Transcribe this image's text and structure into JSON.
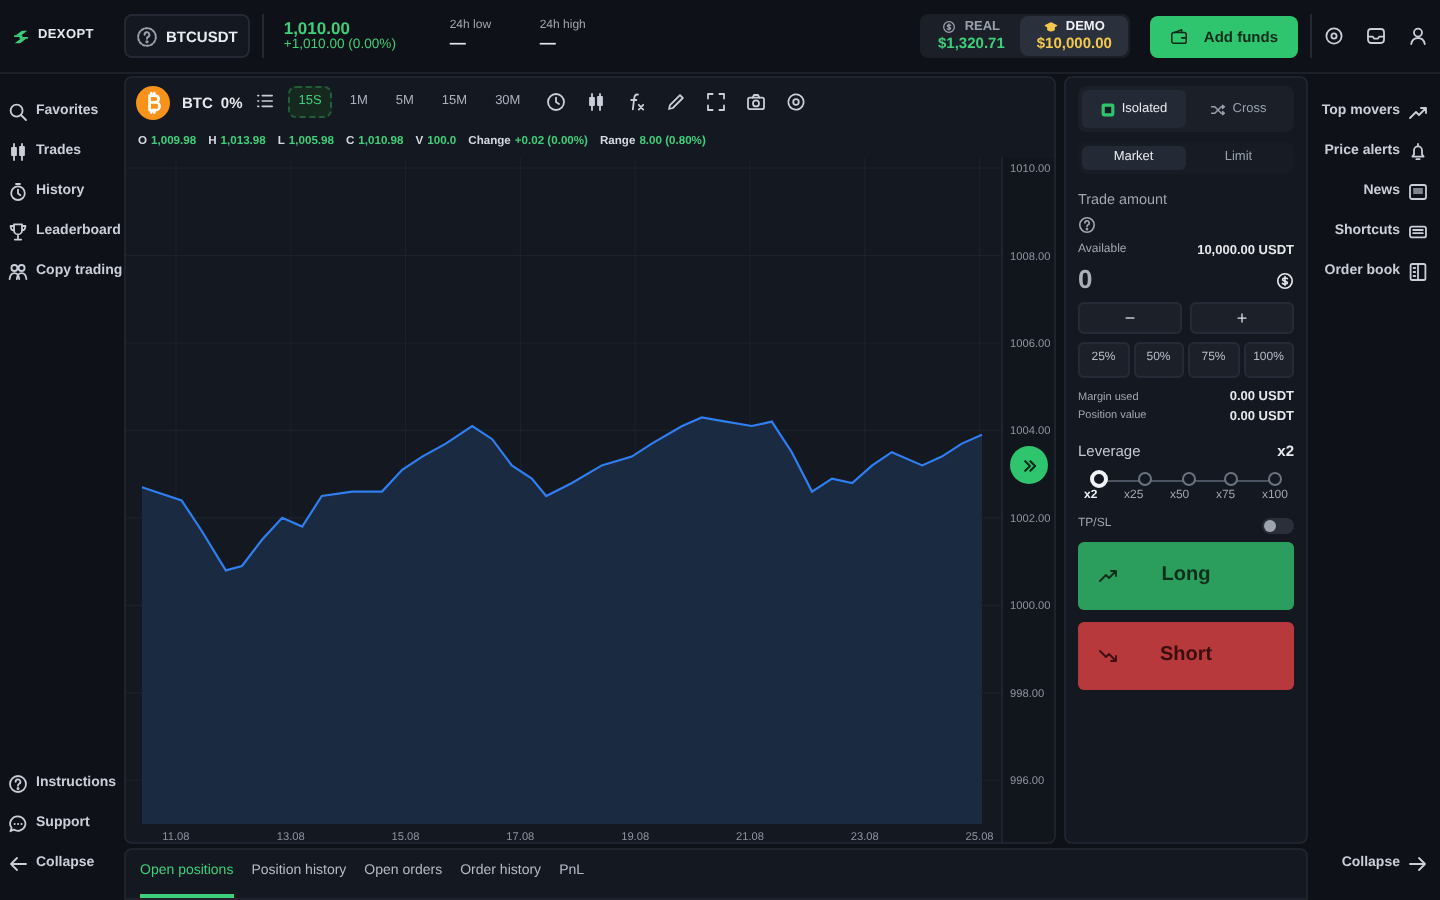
{
  "brand": {
    "name": "DEXOPT"
  },
  "symbol": {
    "name": "BTCUSDT"
  },
  "price": {
    "last": "1,010.00",
    "change": "+1,010.00 (0.00%)"
  },
  "stats": [
    {
      "label": "24h low",
      "value": "—"
    },
    {
      "label": "24h high",
      "value": "—"
    }
  ],
  "accounts": [
    {
      "label": "REAL",
      "balance": "$1,320.71",
      "color": "#3fcf7a",
      "selected": false
    },
    {
      "label": "DEMO",
      "balance": "$10,000.00",
      "color": "#f2c94c",
      "selected": true
    }
  ],
  "add_funds": "Add funds",
  "left_nav": [
    {
      "label": "Favorites"
    },
    {
      "label": "Trades"
    },
    {
      "label": "History"
    },
    {
      "label": "Leaderboard"
    },
    {
      "label": "Copy trading"
    }
  ],
  "left_footer": [
    {
      "label": "Instructions"
    },
    {
      "label": "Support"
    },
    {
      "label": "Collapse"
    }
  ],
  "chart": {
    "asset": "BTC",
    "change": "0%",
    "intervals": [
      {
        "label": "15S",
        "selected": true
      },
      {
        "label": "1M",
        "selected": false
      },
      {
        "label": "5M",
        "selected": false
      },
      {
        "label": "15M",
        "selected": false
      },
      {
        "label": "30M",
        "selected": false
      }
    ],
    "ohlc": [
      {
        "key": "O",
        "value": "1,009.98"
      },
      {
        "key": "H",
        "value": "1,013.98"
      },
      {
        "key": "L",
        "value": "1,005.98"
      },
      {
        "key": "C",
        "value": "1,010.98"
      },
      {
        "key": "V",
        "value": "100.0"
      },
      {
        "key": "Change",
        "value": "+0.02 (0.00%)"
      },
      {
        "key": "Range",
        "value": "8.00 (0.80%)"
      }
    ],
    "chart_data": {
      "type": "area",
      "grid": true,
      "xlim": [
        10.21,
        25.47
      ],
      "ylim": [
        995,
        1010.23
      ],
      "x": [
        10.49,
        11.18,
        11.53,
        11.95,
        12.23,
        12.58,
        12.93,
        13.28,
        13.62,
        14.15,
        14.67,
        15.02,
        15.37,
        15.78,
        16.24,
        16.59,
        16.93,
        17.28,
        17.53,
        17.98,
        18.5,
        19.02,
        19.37,
        19.9,
        20.24,
        20.66,
        21.11,
        21.46,
        21.81,
        22.16,
        22.51,
        22.86,
        23.21,
        23.55,
        24.08,
        24.42,
        24.77,
        25.12
      ],
      "series": [
        {
          "color": "#2f7ff0",
          "values": [
            1002.7,
            1002.4,
            1001.7,
            1000.8,
            1000.9,
            1001.5,
            1002.0,
            1001.8,
            1002.5,
            1002.6,
            1002.6,
            1003.1,
            1003.4,
            1003.7,
            1004.1,
            1003.8,
            1003.2,
            1002.9,
            1002.5,
            1002.8,
            1003.2,
            1003.4,
            1003.7,
            1004.1,
            1004.3,
            1004.2,
            1004.1,
            1004.2,
            1003.5,
            1002.6,
            1002.9,
            1002.8,
            1003.2,
            1003.5,
            1003.2,
            1003.4,
            1003.7,
            1003.9
          ]
        }
      ],
      "xticks": [
        {
          "value": 11.08,
          "label": "11.08"
        },
        {
          "value": 13.08,
          "label": "13.08"
        },
        {
          "value": 15.08,
          "label": "15.08"
        },
        {
          "value": 17.08,
          "label": "17.08"
        },
        {
          "value": 19.08,
          "label": "19.08"
        },
        {
          "value": 21.08,
          "label": "21.08"
        },
        {
          "value": 23.08,
          "label": "23.08"
        },
        {
          "value": 25.08,
          "label": "25.08"
        }
      ],
      "yticks": [
        {
          "value": 996,
          "label": "996.00"
        },
        {
          "value": 998,
          "label": "998.00"
        },
        {
          "value": 1000,
          "label": "1000.00"
        },
        {
          "value": 1002,
          "label": "1002.00"
        },
        {
          "value": 1004,
          "label": "1004.00"
        },
        {
          "value": 1006,
          "label": "1006.00"
        },
        {
          "value": 1008,
          "label": "1008.00"
        },
        {
          "value": 1010,
          "label": "1010.00"
        }
      ]
    }
  },
  "trade": {
    "margin_modes": [
      {
        "label": "Isolated",
        "selected": true
      },
      {
        "label": "Cross",
        "selected": false
      }
    ],
    "order_types": [
      {
        "label": "Market",
        "selected": true
      },
      {
        "label": "Limit",
        "selected": false
      }
    ],
    "amount_label": "Trade amount",
    "available_label": "Available",
    "available": "10,000.00 USDT",
    "amount": "0",
    "steppers": [
      "−",
      "+"
    ],
    "presets": [
      "25%",
      "50%",
      "75%",
      "100%"
    ],
    "rows": [
      {
        "label": "Margin used",
        "value": "0.00 USDT"
      },
      {
        "label": "Position value",
        "value": "0.00 USDT"
      }
    ],
    "leverage_label": "Leverage",
    "leverage": "x2",
    "leverage_steps": [
      {
        "label": "x2",
        "selected": true
      },
      {
        "label": "x25",
        "selected": false
      },
      {
        "label": "x50",
        "selected": false
      },
      {
        "label": "x75",
        "selected": false
      },
      {
        "label": "x100",
        "selected": false
      }
    ],
    "tpsl": {
      "label": "TP/SL",
      "on": false
    },
    "long": "Long",
    "short": "Short"
  },
  "right_nav": [
    {
      "label": "Top movers"
    },
    {
      "label": "Price alerts"
    },
    {
      "label": "News"
    },
    {
      "label": "Shortcuts"
    },
    {
      "label": "Order book"
    }
  ],
  "right_footer": {
    "label": "Collapse"
  },
  "bottom_tabs": [
    {
      "label": "Open positions",
      "selected": true
    },
    {
      "label": "Position history",
      "selected": false
    },
    {
      "label": "Open orders",
      "selected": false
    },
    {
      "label": "Order history",
      "selected": false
    },
    {
      "label": "PnL",
      "selected": false
    }
  ]
}
